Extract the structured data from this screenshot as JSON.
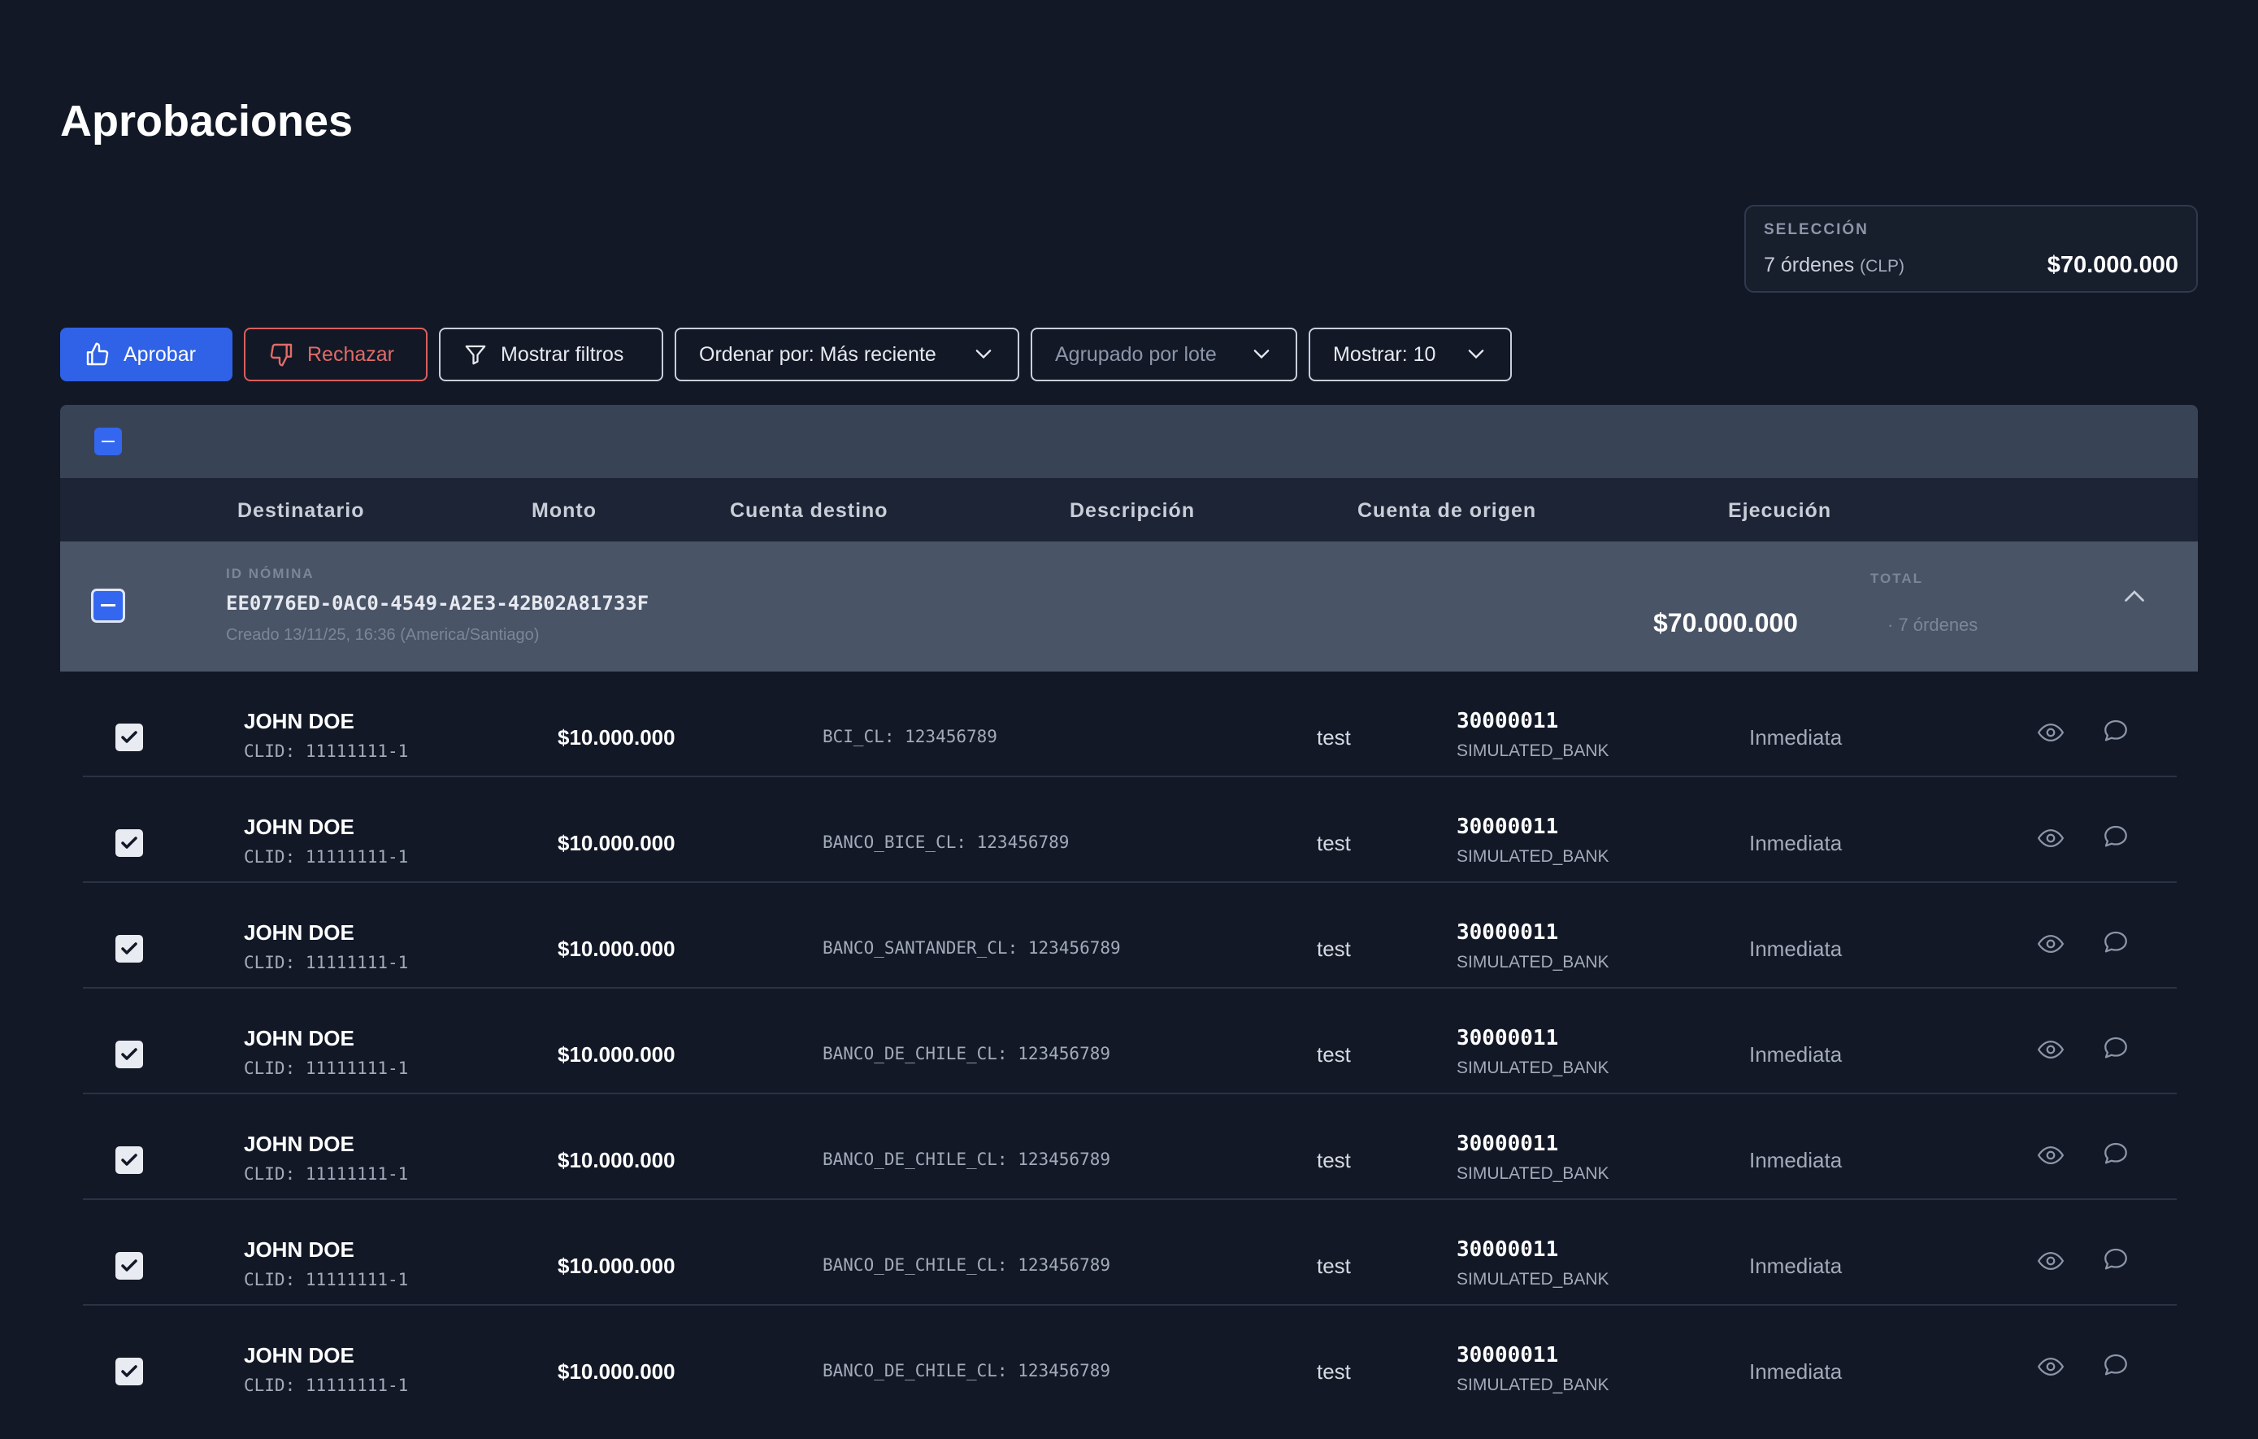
{
  "page": {
    "title": "Aprobaciones"
  },
  "selection": {
    "label": "SELECCIÓN",
    "count": "7 órdenes",
    "currency": "(CLP)",
    "amount": "$70.000.000"
  },
  "toolbar": {
    "approve": "Aprobar",
    "reject": "Rechazar",
    "filters": "Mostrar filtros",
    "sort": "Ordenar por: Más reciente",
    "group": "Agrupado por lote",
    "show": "Mostrar: 10"
  },
  "columns": [
    "Destinatario",
    "Monto",
    "Cuenta destino",
    "Descripción",
    "Cuenta de origen",
    "Ejecución"
  ],
  "batch": {
    "label": "ID NÓMINA",
    "id": "EE0776ED-0AC0-4549-A2E3-42B02A81733F",
    "created": "Creado 13/11/25, 16:36 (America/Santiago)",
    "total_label": "TOTAL",
    "total": "$70.000.000",
    "count": "· 7 órdenes"
  },
  "rows": [
    {
      "name": "JOHN DOE",
      "clid": "CLID: 11111111-1",
      "amount": "$10.000.000",
      "account": "BCI_CL: 123456789",
      "desc": "test",
      "origin": "30000011",
      "bank": "SIMULATED_BANK",
      "exec": "Inmediata"
    },
    {
      "name": "JOHN DOE",
      "clid": "CLID: 11111111-1",
      "amount": "$10.000.000",
      "account": "BANCO_BICE_CL: 123456789",
      "desc": "test",
      "origin": "30000011",
      "bank": "SIMULATED_BANK",
      "exec": "Inmediata"
    },
    {
      "name": "JOHN DOE",
      "clid": "CLID: 11111111-1",
      "amount": "$10.000.000",
      "account": "BANCO_SANTANDER_CL: 123456789",
      "desc": "test",
      "origin": "30000011",
      "bank": "SIMULATED_BANK",
      "exec": "Inmediata"
    },
    {
      "name": "JOHN DOE",
      "clid": "CLID: 11111111-1",
      "amount": "$10.000.000",
      "account": "BANCO_DE_CHILE_CL: 123456789",
      "desc": "test",
      "origin": "30000011",
      "bank": "SIMULATED_BANK",
      "exec": "Inmediata"
    },
    {
      "name": "JOHN DOE",
      "clid": "CLID: 11111111-1",
      "amount": "$10.000.000",
      "account": "BANCO_DE_CHILE_CL: 123456789",
      "desc": "test",
      "origin": "30000011",
      "bank": "SIMULATED_BANK",
      "exec": "Inmediata"
    },
    {
      "name": "JOHN DOE",
      "clid": "CLID: 11111111-1",
      "amount": "$10.000.000",
      "account": "BANCO_DE_CHILE_CL: 123456789",
      "desc": "test",
      "origin": "30000011",
      "bank": "SIMULATED_BANK",
      "exec": "Inmediata"
    },
    {
      "name": "JOHN DOE",
      "clid": "CLID: 11111111-1",
      "amount": "$10.000.000",
      "account": "BANCO_DE_CHILE_CL: 123456789",
      "desc": "test",
      "origin": "30000011",
      "bank": "SIMULATED_BANK",
      "exec": "Inmediata"
    }
  ],
  "colors": {
    "accent": "#2f62e6",
    "danger": "#d9605d",
    "background": "#121826",
    "batch": "#4a5467"
  }
}
